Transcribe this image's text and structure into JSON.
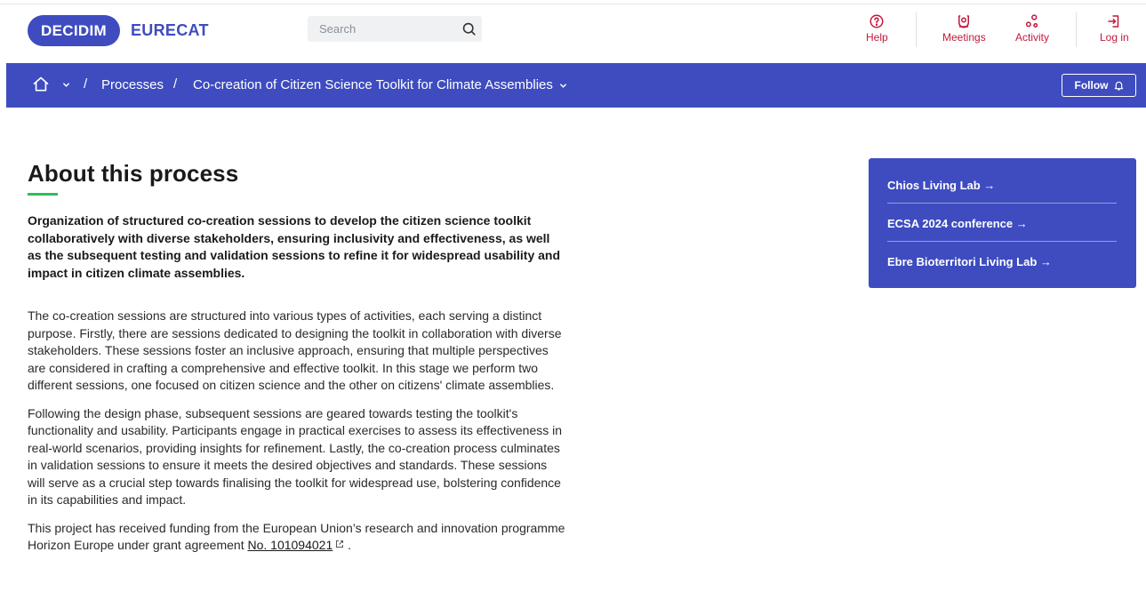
{
  "header": {
    "logo_text": "DECIDIM",
    "org_name": "EURECAT",
    "search_placeholder": "Search",
    "nav": {
      "help": "Help",
      "meetings": "Meetings",
      "activity": "Activity",
      "login": "Log in"
    }
  },
  "breadcrumb": {
    "separator": "/",
    "processes": "Processes",
    "current": "Co-creation of Citizen Science Toolkit for Climate Assemblies",
    "follow_label": "Follow"
  },
  "main": {
    "title": "About this process",
    "lead": "Organization of structured co-creation sessions to develop the citizen science toolkit collaboratively with diverse stakeholders, ensuring inclusivity and effectiveness, as well as the subsequent testing and validation sessions to refine it for widespread usability and impact in citizen climate assemblies.",
    "paragraph1": "The co-creation sessions are structured into various types of activities, each serving a distinct purpose. Firstly, there are sessions dedicated to designing the toolkit in collaboration with diverse stakeholders. These sessions foster an inclusive approach, ensuring that multiple perspectives are considered in crafting a comprehensive and effective toolkit. In this stage we perform two different sessions, one focused on citizen science and the other on citizens' climate assemblies.",
    "paragraph2": "Following the design phase, subsequent sessions are geared towards testing the toolkit's functionality and usability. Participants engage in practical exercises to assess its effectiveness in real-world scenarios, providing insights for refinement. Lastly, the co-creation process culminates in validation sessions to ensure it meets the desired objectives and standards. These sessions will serve as a crucial step towards finalising the toolkit for widespread use, bolstering confidence in its capabilities and impact.",
    "funding_text": "This project has received funding from the European Union’s research and innovation programme Horizon Europe under grant agreement ",
    "grant_link": "No. 101094021",
    "funding_end": "."
  },
  "sidebar": {
    "links": [
      {
        "label": "Chios Living Lab →"
      },
      {
        "label": "ECSA 2024 conference →"
      },
      {
        "label": "Ebre Bioterritori Living Lab →"
      }
    ]
  },
  "colors": {
    "brand_blue": "#3e4cc0",
    "nav_red": "#c2193b",
    "accent_green": "#2ebd59"
  }
}
